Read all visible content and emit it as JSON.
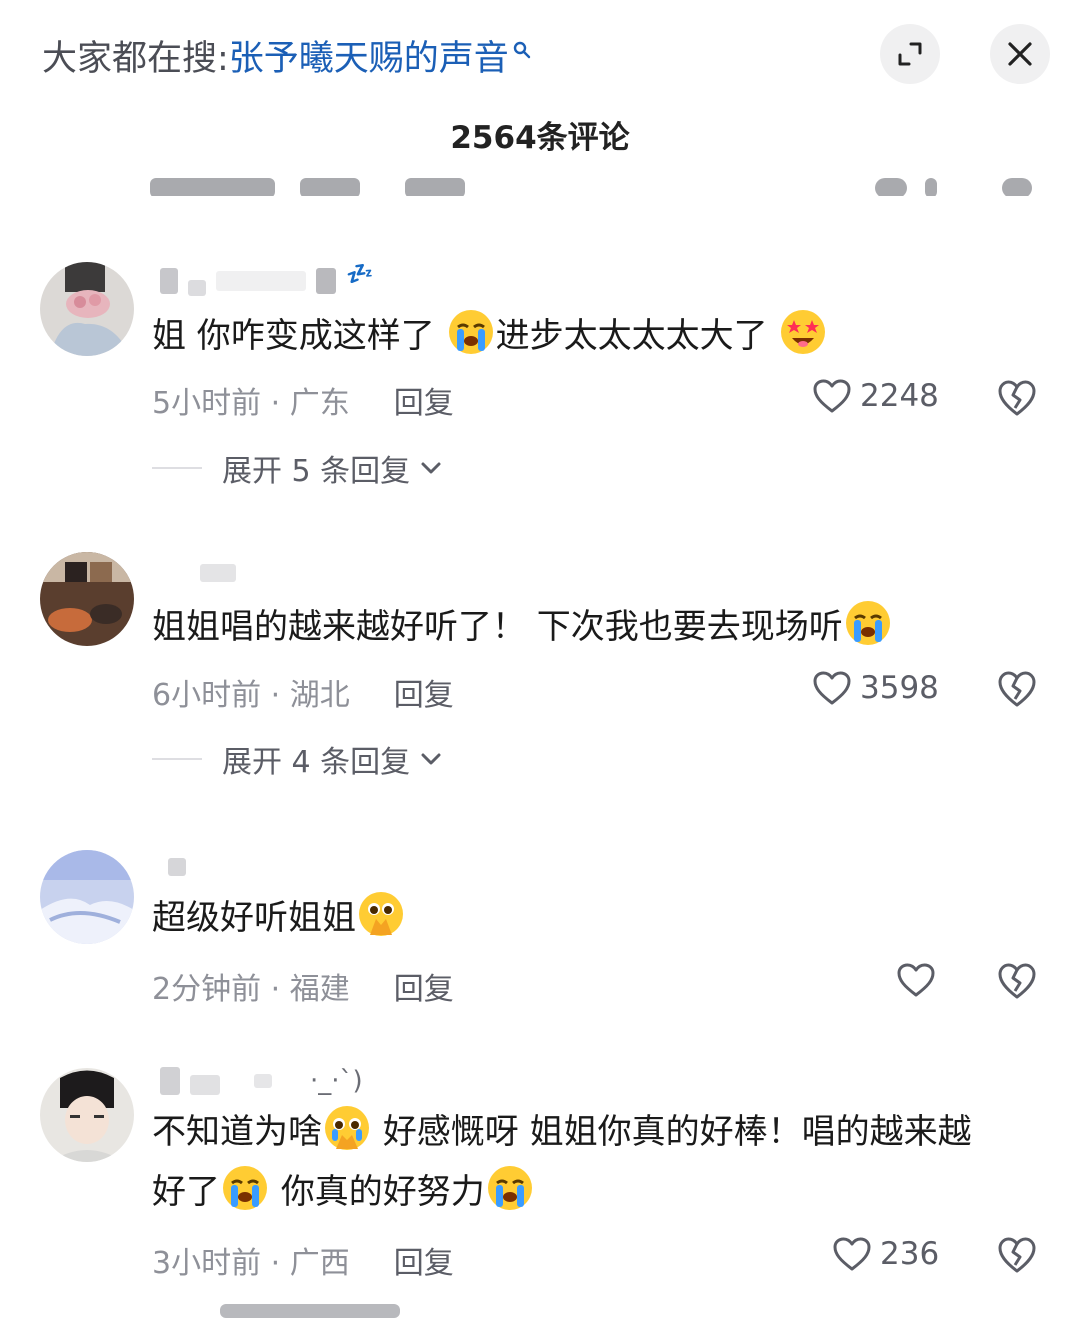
{
  "header": {
    "search_prefix": "大家都在搜:",
    "search_term": "张予曦天赐的声音",
    "comment_count": "2564条评论"
  },
  "icons": {
    "search": "search-icon",
    "fullscreen": "expand-icon",
    "close": "close-icon",
    "like": "heart-outline-icon",
    "dislike": "broken-heart-icon",
    "chevron": "chevron-down-icon"
  },
  "comments": [
    {
      "username_suffix": "💤",
      "text_1": "姐 你咋变成这样了",
      "text_2": "进步太太太太大了",
      "emoji_1": "loudly-crying-emoji",
      "emoji_2": "star-struck-emoji",
      "meta": "5小时前 · 广东",
      "reply_label": "回复",
      "likes": "2248",
      "expand": "展开 5 条回复"
    },
    {
      "text_1": "姐姐唱的越来越好听了！ 下次我也要去现场听",
      "emoji_1": "loudly-crying-emoji",
      "meta": "6小时前 · 湖北",
      "reply_label": "回复",
      "likes": "3598",
      "expand": "展开 4 条回复"
    },
    {
      "text_1": "超级好听姐姐",
      "emoji_1": "pleading-hands-emoji",
      "meta": "2分钟前 · 福建",
      "reply_label": "回复",
      "likes": ""
    },
    {
      "username_suffix": "·_·`)",
      "text_1": "不知道为啥",
      "text_2": "好感慨呀 姐姐你真的好棒！唱的越来越",
      "text_3": "好了",
      "text_4": "你真的好努力",
      "emoji_1": "holding-back-tears-emoji",
      "emoji_2": "loudly-crying-emoji",
      "emoji_3": "loudly-crying-emoji",
      "meta": "3小时前 · 广西",
      "reply_label": "回复",
      "likes": "236"
    }
  ]
}
